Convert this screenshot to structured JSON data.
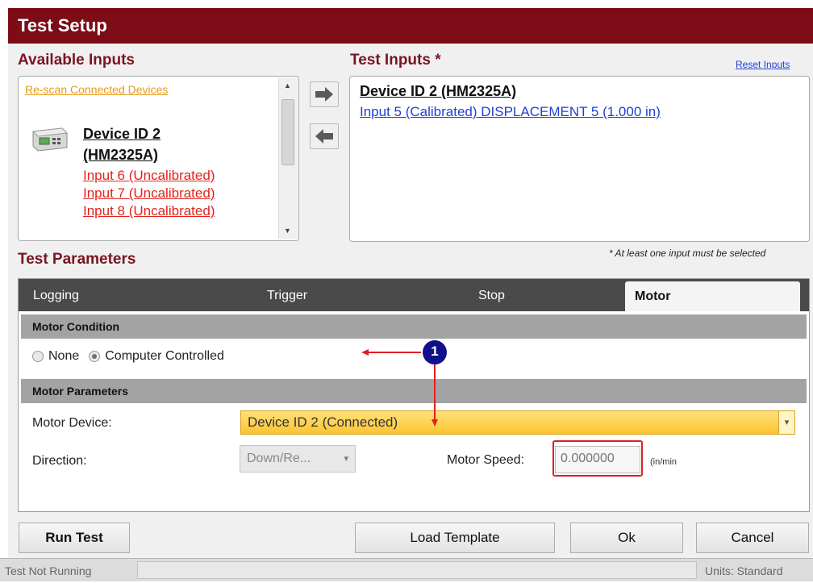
{
  "window": {
    "title": "Test Setup"
  },
  "available_inputs": {
    "title": "Available Inputs",
    "rescan_link": "Re-scan Connected Devices",
    "device_name_line1": "Device ID 2",
    "device_name_line2": "(HM2325A)",
    "inputs": [
      "Input 6 (Uncalibrated)",
      "Input 7 (Uncalibrated)",
      "Input 8 (Uncalibrated)"
    ]
  },
  "test_inputs": {
    "title": "Test Inputs *",
    "reset_link": "Reset Inputs",
    "device_name": "Device ID 2 (HM2325A)",
    "inputs": [
      "Input 5 (Calibrated) DISPLACEMENT 5 (1.000 in)"
    ],
    "note": "* At least one input must be selected"
  },
  "test_parameters": {
    "title": "Test Parameters",
    "tabs": [
      "Logging",
      "Trigger",
      "Stop",
      "Motor"
    ],
    "selected_tab": "Motor"
  },
  "motor": {
    "condition_header": "Motor Condition",
    "radio_none": "None",
    "radio_computer": "Computer Controlled",
    "selected_condition": "Computer Controlled",
    "params_header": "Motor Parameters",
    "device_label": "Motor Device:",
    "device_value": "Device ID 2 (Connected)",
    "direction_label": "Direction:",
    "direction_value": "Down/Re...",
    "speed_label": "Motor Speed:",
    "speed_value": "0.000000",
    "speed_unit": "(in/min"
  },
  "annotation": {
    "marker": "1"
  },
  "buttons": {
    "run": "Run Test",
    "load": "Load Template",
    "ok": "Ok",
    "cancel": "Cancel"
  },
  "status": {
    "left": "Test Not Running",
    "right": "Units: Standard"
  },
  "colors": {
    "title_bar": "#7d0c17",
    "section_title": "#7a1521",
    "annotation_red": "#e02020",
    "annotation_marker": "#10108a"
  }
}
